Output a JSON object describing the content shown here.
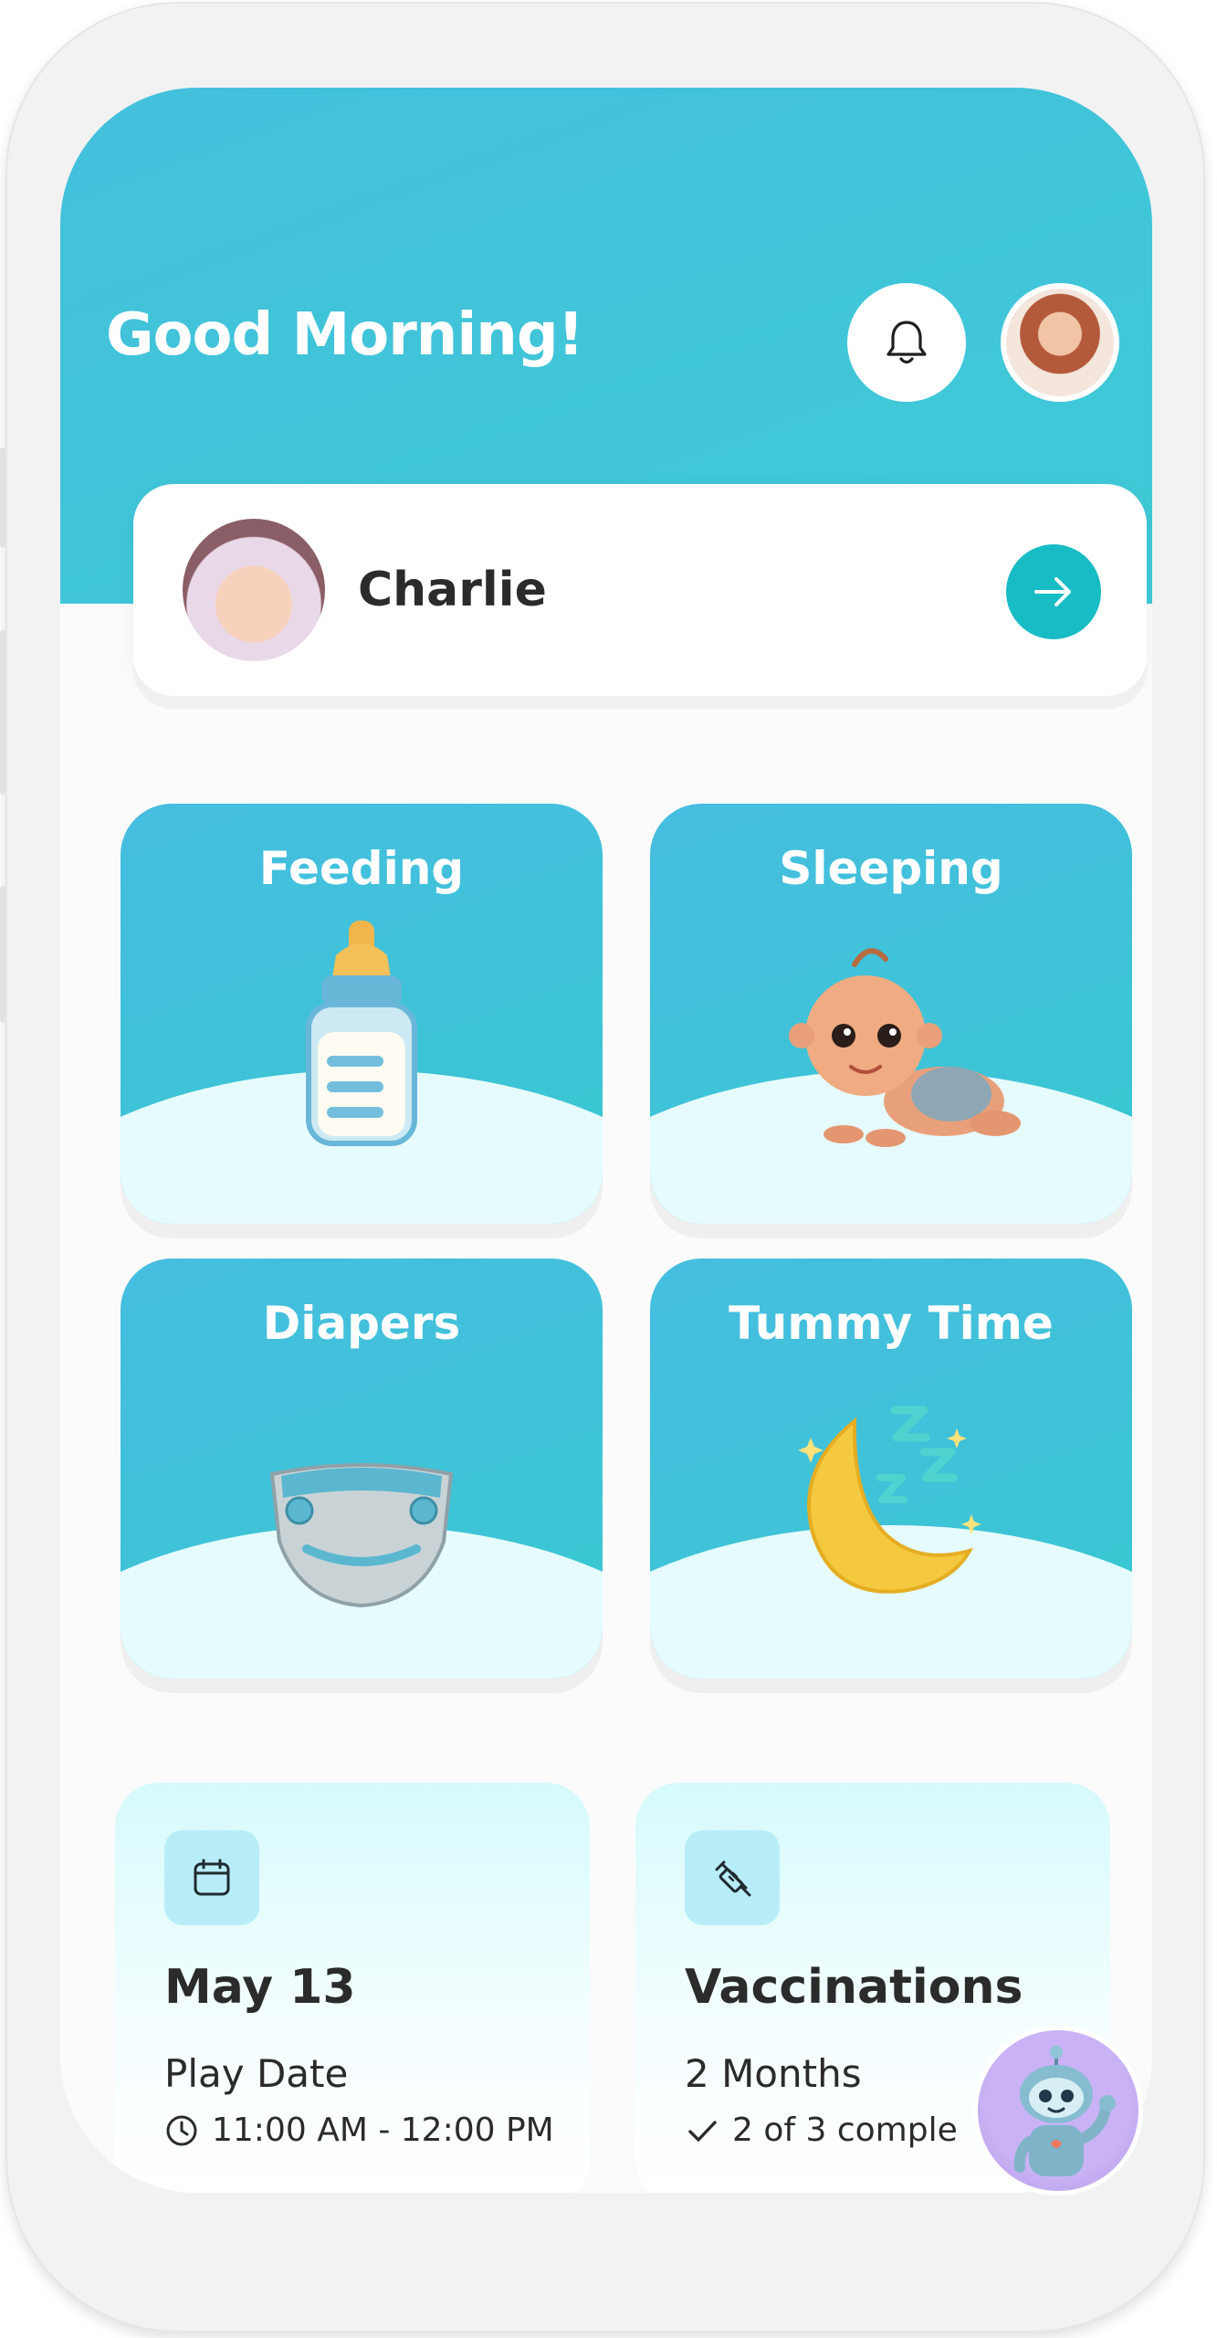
{
  "header": {
    "greeting": "Good Morning!"
  },
  "icons": {
    "bell": "bell-icon",
    "arrow": "arrow-right-icon",
    "calendar": "calendar-icon",
    "syringe": "syringe-icon",
    "clock": "clock-icon",
    "check": "check-icon"
  },
  "baby": {
    "name": "Charlie"
  },
  "tiles": [
    {
      "label": "Feeding",
      "art": "baby-bottle"
    },
    {
      "label": "Sleeping",
      "art": "crawling-baby"
    },
    {
      "label": "Diapers",
      "art": "diaper"
    },
    {
      "label": "Tummy Time",
      "art": "sleeping-moon"
    }
  ],
  "cards": [
    {
      "title": "May 13",
      "subtitle": "Play Date",
      "meta": "11:00 AM - 12:00 PM"
    },
    {
      "title": "Vaccinations",
      "subtitle": "2 Months",
      "meta": "2 of 3 comple"
    }
  ],
  "colors": {
    "primary": "#3ec5d9",
    "accent": "#18bcc4",
    "tile_hill": "#e6fbfd",
    "text_dark": "#2b2b2b"
  }
}
